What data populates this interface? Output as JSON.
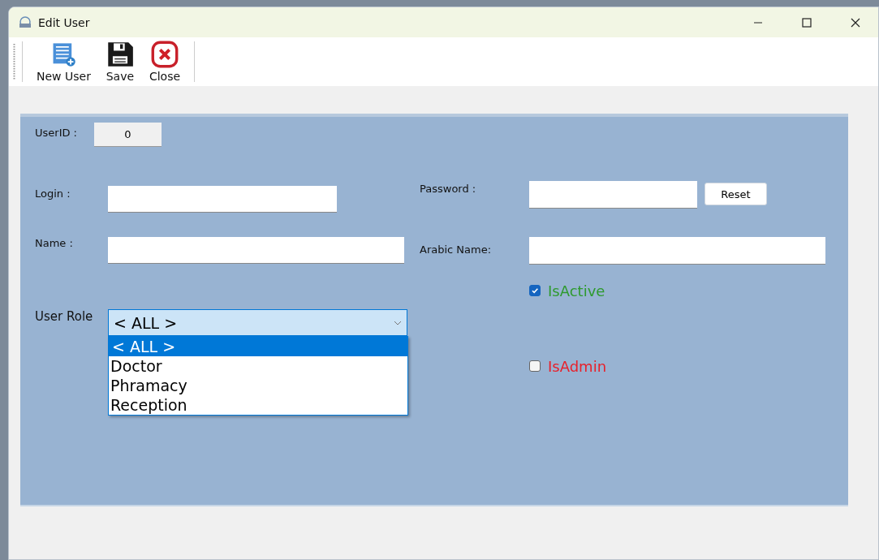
{
  "window": {
    "title": "Edit User"
  },
  "toolbar": [
    {
      "label": "New User",
      "kind": "new"
    },
    {
      "label": "Save",
      "kind": "save"
    },
    {
      "label": "Close",
      "kind": "close"
    }
  ],
  "form": {
    "user_id": {
      "label": "UserID :",
      "value": "0"
    },
    "login": {
      "label": "Login :"
    },
    "password": {
      "label": "Password :",
      "button": "Reset"
    },
    "name": {
      "label": "Name :"
    },
    "arabic_name": {
      "label": "Arabic Name:"
    },
    "checkboxes": [
      {
        "label": "IsActive",
        "checked": true,
        "color": "#2e9a2e"
      },
      {
        "label": "IsAdmin",
        "checked": false,
        "color": "#e8202a"
      }
    ],
    "user_role": {
      "label": "User Role",
      "value": "< ALL >",
      "expanded": true,
      "options": [
        {
          "label": "< ALL >",
          "selected": true
        },
        {
          "label": "Doctor",
          "selected": false
        },
        {
          "label": "Phramacy",
          "selected": false
        },
        {
          "label": "Reception",
          "selected": false
        }
      ]
    }
  }
}
